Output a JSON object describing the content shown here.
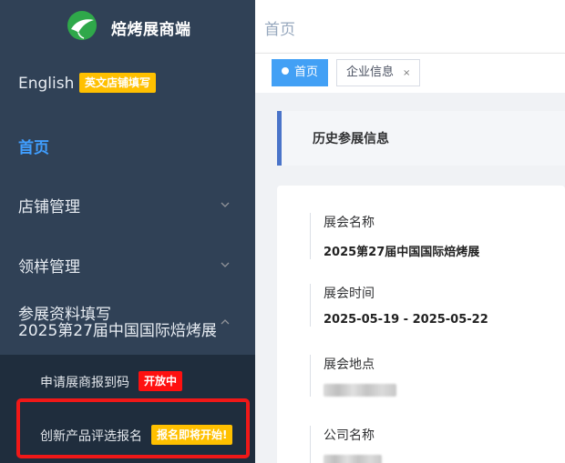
{
  "app": {
    "title": "焙烤展商端"
  },
  "sidebar": {
    "lang": {
      "label": "English",
      "badge": "英文店铺填写"
    },
    "items": [
      {
        "label": "首页",
        "active": true
      },
      {
        "label": "店铺管理",
        "icon": "chevron-down-icon"
      },
      {
        "label": "领样管理",
        "icon": "chevron-down-icon"
      },
      {
        "label": "参展资料填写",
        "subtitle": "2025第27届中国国际焙烤展",
        "icon": "chevron-up-icon",
        "expanded": true
      }
    ],
    "submenu": [
      {
        "label": "申请展商报到码",
        "badge": "开放中",
        "badge_color": "#ff1010"
      },
      {
        "label": "创新产品评选报名",
        "badge": "报名即将开始!",
        "badge_color": "#ffc000"
      }
    ],
    "active_color": "#409eff",
    "bg_color": "#304156"
  },
  "navbar": {
    "breadcrumb": "首页"
  },
  "tags": {
    "items": [
      {
        "label": "首页",
        "active": true
      },
      {
        "label": "企业信息",
        "closable": true,
        "close_glyph": "×"
      }
    ]
  },
  "main": {
    "history_title": "历史参展信息",
    "fields": [
      {
        "label": "展会名称",
        "value": "2025第27届中国国际焙烤展"
      },
      {
        "label": "展会时间",
        "value": "2025-05-19 - 2025-05-22"
      },
      {
        "label": "展会地点",
        "value": ""
      },
      {
        "label": "公司名称",
        "value": ""
      }
    ]
  }
}
